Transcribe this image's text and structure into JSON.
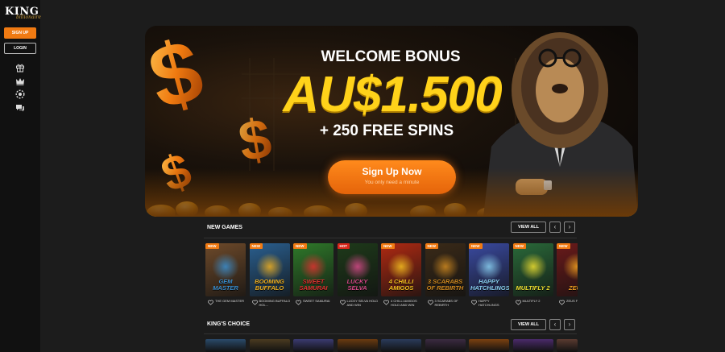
{
  "brand": {
    "name": "KING",
    "tagline": "billionaire",
    "accent": "#f07a12"
  },
  "sidebar": {
    "signup_label": "SIGN UP",
    "login_label": "LOGIN",
    "icons": [
      "gift-icon",
      "crown-icon",
      "poker-chip-icon",
      "chat-icon"
    ]
  },
  "banner": {
    "headline": "WELCOME BONUS",
    "amount": "AU$1.500",
    "spins": "+ 250 FREE SPINS",
    "cta_label": "Sign Up Now",
    "cta_sub": "You only need a minute"
  },
  "new_games": {
    "title": "NEW GAMES",
    "view_all": "VIEW ALL",
    "games": [
      {
        "title": "GEM MASTER",
        "name": "THE GEM MASTER",
        "badge": "NEW",
        "bg": "#6e4a2a",
        "accent": "#3a8fd0"
      },
      {
        "title": "BOOMING BUFFALO",
        "name": "BOOMING BUFFALO HOL...",
        "badge": "NEW",
        "bg": "#2a5f8f",
        "accent": "#f0b020"
      },
      {
        "title": "SWEET SAMURAI",
        "name": "SWEET SAMURAI",
        "badge": "NEW",
        "bg": "#2f7a2a",
        "accent": "#e23030"
      },
      {
        "title": "LUCKY SELVA",
        "name": "LUCKY SELVA HOLD AND WIN",
        "badge": "HOT",
        "bg": "#1e3a1a",
        "accent": "#d84a8a"
      },
      {
        "title": "4 CHILLI AMIGOS",
        "name": "4 CHILLI AMIGOS HOLD AND WIN",
        "badge": "NEW",
        "bg": "#b02a12",
        "accent": "#f5c020"
      },
      {
        "title": "3 SCARABS OF REBIRTH",
        "name": "3 SCARABS OF REBIRTH",
        "badge": "NEW",
        "bg": "#3a2a18",
        "accent": "#d08a20"
      },
      {
        "title": "HAPPY HATCHLINGS",
        "name": "HAPPY HATCHLINGS",
        "badge": "NEW",
        "bg": "#3a4aa0",
        "accent": "#8ad0f0"
      },
      {
        "title": "MULTIFLY 2",
        "name": "MULTIFLY 2",
        "badge": "NEW",
        "bg": "#2a6a3a",
        "accent": "#f0e030"
      },
      {
        "title": "ZEUS",
        "name": "ZEUS FURY",
        "badge": "NEW",
        "bg": "#6a1a1a",
        "accent": "#f0a020"
      }
    ]
  },
  "kings_choice": {
    "title": "KING'S CHOICE",
    "view_all": "VIEW ALL",
    "thumb_colors": [
      "#2a4a6a",
      "#4a3a20",
      "#3a3a70",
      "#6a3a10",
      "#2a3a5a",
      "#3a2a40",
      "#7a4010",
      "#4a2a6a",
      "#5a3a30"
    ]
  },
  "nav": {
    "prev": "‹",
    "next": "›"
  }
}
